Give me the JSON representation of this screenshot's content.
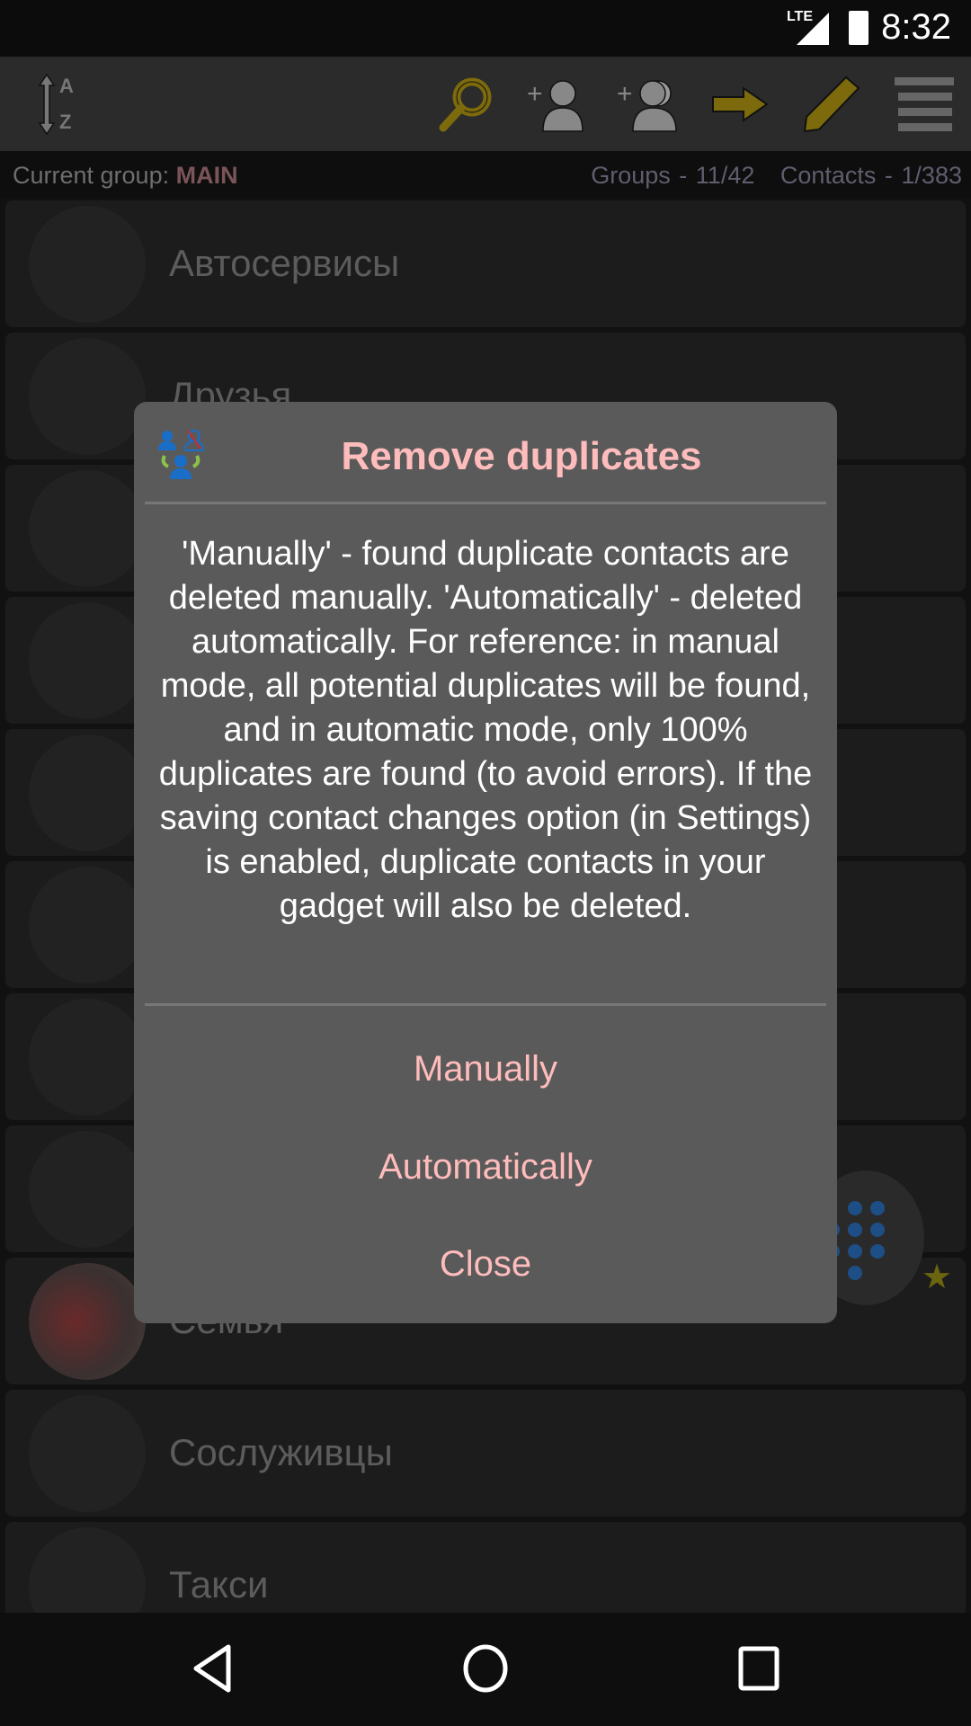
{
  "status_bar": {
    "network": "LTE",
    "time": "8:32"
  },
  "toolbar": {
    "icons": [
      "sort-az-icon",
      "search-icon",
      "add-contact-icon",
      "add-group-icon",
      "move-arrow-icon",
      "edit-pencil-icon",
      "menu-icon"
    ],
    "sort_top": "A",
    "sort_bottom": "Z"
  },
  "info": {
    "group_label": "Current group: ",
    "group_name": "MAIN",
    "groups": "Groups - 11/42",
    "contacts": "Contacts - 1/383"
  },
  "groups": [
    {
      "name": "Автосервисы"
    },
    {
      "name": "Друзья"
    },
    {
      "name": ""
    },
    {
      "name": ""
    },
    {
      "name": ""
    },
    {
      "name": ""
    },
    {
      "name": ""
    },
    {
      "name": ""
    },
    {
      "name": "Семья"
    },
    {
      "name": "Сослуживцы"
    },
    {
      "name": "Такси"
    }
  ],
  "dialog": {
    "title": "Remove duplicates",
    "message": "'Manually' - found duplicate contacts are deleted manually. 'Automatically' - deleted automatically. For reference: in manual mode, all potential duplicates will be found, and in automatic mode, only 100% duplicates are found (to avoid errors). If the saving contact changes option (in Settings) is enabled, duplicate contacts in your gadget will also be deleted.",
    "buttons": {
      "manually": "Manually",
      "automatically": "Automatically",
      "close": "Close"
    }
  },
  "colors": {
    "accent": "#ffbcbc",
    "toolbar_icon": "#8a7410",
    "dialog_bg": "#5a5a5a"
  }
}
